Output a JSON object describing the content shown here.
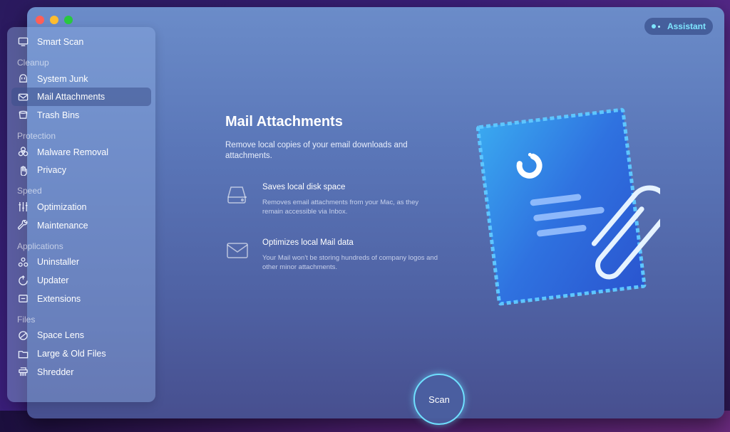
{
  "sidebar": {
    "smart_scan": "Smart Scan",
    "sections": {
      "cleanup": "Cleanup",
      "protection": "Protection",
      "speed": "Speed",
      "applications": "Applications",
      "files": "Files"
    },
    "items": {
      "system_junk": "System Junk",
      "mail_attachments": "Mail Attachments",
      "trash_bins": "Trash Bins",
      "malware_removal": "Malware Removal",
      "privacy": "Privacy",
      "optimization": "Optimization",
      "maintenance": "Maintenance",
      "uninstaller": "Uninstaller",
      "updater": "Updater",
      "extensions": "Extensions",
      "space_lens": "Space Lens",
      "large_old_files": "Large & Old Files",
      "shredder": "Shredder"
    },
    "active": "mail_attachments"
  },
  "header": {
    "assistant_label": "Assistant"
  },
  "main": {
    "title": "Mail Attachments",
    "subtitle": "Remove local copies of your email downloads and attachments.",
    "features": [
      {
        "icon": "disk-icon",
        "title": "Saves local disk space",
        "description": "Removes email attachments from your Mac, as they remain accessible via Inbox."
      },
      {
        "icon": "envelope-icon",
        "title": "Optimizes local Mail data",
        "description": "Your Mail won't be storing hundreds of company logos and other minor attachments."
      }
    ]
  },
  "scan_button": {
    "label": "Scan"
  },
  "colors": {
    "accent": "#6fe0ff",
    "stamp_blue": "#2f6fe0"
  }
}
